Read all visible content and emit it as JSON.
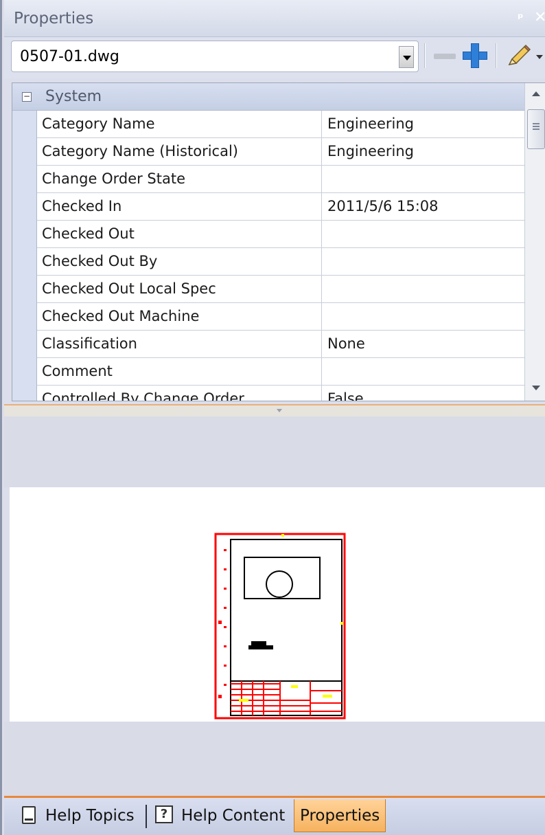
{
  "panel": {
    "title": "Properties",
    "pin_glyph": "ᵖ",
    "close_glyph": "✕"
  },
  "toolbar": {
    "file_selector_value": "0507-01.dwg",
    "icons": [
      "dropdown-arrow-icon",
      "remove-icon",
      "add-icon",
      "edit-pencil-icon",
      "dropdown-arrow-icon"
    ]
  },
  "property_grid": {
    "category": {
      "label": "System",
      "toggle": "−"
    },
    "rows": [
      {
        "name": "Category Name",
        "value": "Engineering"
      },
      {
        "name": "Category Name (Historical)",
        "value": "Engineering"
      },
      {
        "name": "Change Order State",
        "value": ""
      },
      {
        "name": "Checked In",
        "value": "2011/5/6 15:08"
      },
      {
        "name": "Checked Out",
        "value": ""
      },
      {
        "name": "Checked Out By",
        "value": ""
      },
      {
        "name": "Checked Out Local Spec",
        "value": ""
      },
      {
        "name": "Checked Out Machine",
        "value": ""
      },
      {
        "name": "Classification",
        "value": "None"
      },
      {
        "name": "Comment",
        "value": ""
      },
      {
        "name": "Controlled By Change Order",
        "value": "False"
      }
    ]
  },
  "tabs": [
    {
      "label": "Help Topics",
      "icon": "document-icon",
      "active": false
    },
    {
      "label": "Help Content",
      "icon": "help-icon",
      "active": false
    },
    {
      "label": "Properties",
      "icon": "",
      "active": true
    }
  ],
  "colors": {
    "tab_accent": "#e8893a",
    "active_tab": "#f6b25e",
    "drawing_red": "#ff0000",
    "drawing_yellow": "#ffff00",
    "add_icon_blue": "#2f7fd8"
  }
}
